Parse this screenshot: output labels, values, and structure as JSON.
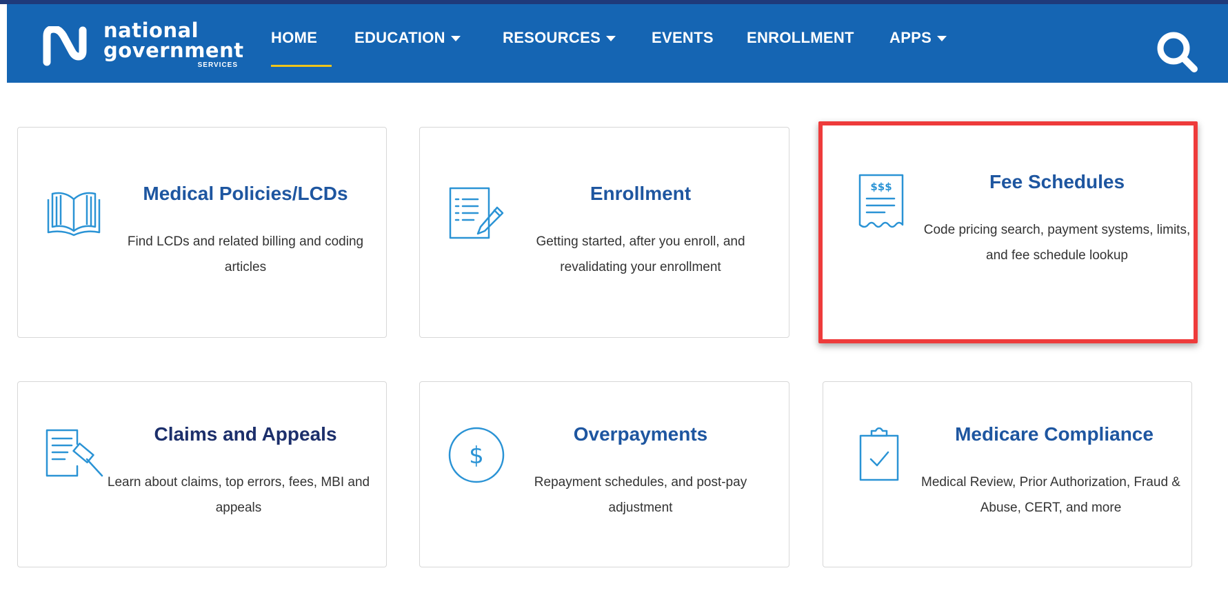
{
  "brand": {
    "line1": "national",
    "line2": "government",
    "line3": "SERVICES"
  },
  "nav": {
    "home": "HOME",
    "education": "EDUCATION",
    "resources": "RESOURCES",
    "events": "EVENTS",
    "enrollment": "ENROLLMENT",
    "apps": "APPS",
    "active": "HOME"
  },
  "icons": {
    "search": "search-icon",
    "book": "open-book-icon",
    "form": "form-pencil-icon",
    "receipt": "receipt-dollar-icon",
    "document_gavel": "document-gavel-icon",
    "dollar": "dollar-circle-icon",
    "clipboard": "clipboard-check-icon"
  },
  "colors": {
    "nav_bg": "#1565b3",
    "title_blue": "#1e56a0",
    "highlight_red": "#ee3b3b",
    "underline_gold": "#f0c419"
  },
  "cards": [
    {
      "title": "Medical Policies/LCDs",
      "desc": "Find LCDs and related billing and coding articles"
    },
    {
      "title": "Enrollment",
      "desc": "Getting started, after you enroll, and revalidating your enrollment"
    },
    {
      "title": "Fee Schedules",
      "desc": "Code pricing search, payment systems, limits, and fee schedule lookup"
    },
    {
      "title": "Claims and Appeals",
      "desc": "Learn about claims, top errors, fees, MBI and appeals"
    },
    {
      "title": "Overpayments",
      "desc": "Repayment schedules, and post-pay adjustment"
    },
    {
      "title": "Medicare Compliance",
      "desc": "Medical Review, Prior Authorization, Fraud & Abuse, CERT, and more"
    }
  ]
}
